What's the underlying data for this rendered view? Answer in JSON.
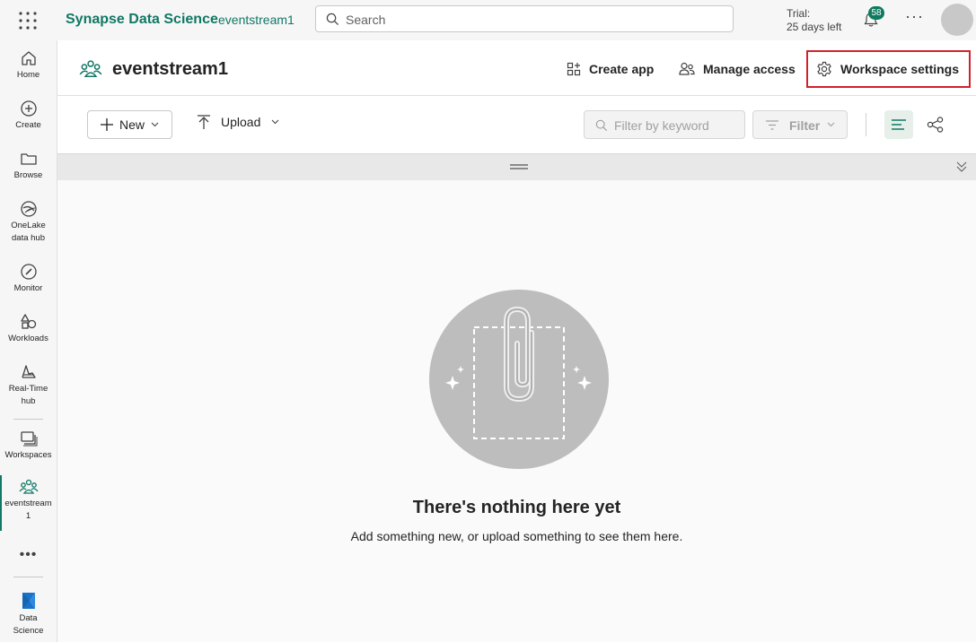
{
  "topbar": {
    "app_name": "Synapse Data Science",
    "workspace_crumb": "eventstream1",
    "search_placeholder": "Search",
    "trial_label": "Trial:",
    "trial_days": "25 days left",
    "notification_count": "58",
    "more_label": "···"
  },
  "rail": {
    "items": [
      {
        "label": "Home",
        "icon": "home-icon"
      },
      {
        "label": "Create",
        "icon": "plus-circle-icon"
      },
      {
        "label": "Browse",
        "icon": "folder-icon"
      },
      {
        "label": "OneLake\ndata hub",
        "icon": "onelake-icon"
      },
      {
        "label": "Monitor",
        "icon": "monitor-icon"
      },
      {
        "label": "Workloads",
        "icon": "workloads-icon"
      },
      {
        "label": "Real-Time\nhub",
        "icon": "realtime-icon"
      },
      {
        "label": "Workspaces",
        "icon": "workspaces-icon"
      },
      {
        "label": "eventstream\n1",
        "icon": "workspace-people-icon"
      },
      {
        "label": "Data\nScience",
        "icon": "data-science-icon"
      }
    ],
    "more_label": "•••"
  },
  "header": {
    "workspace_title": "eventstream1",
    "create_app": "Create app",
    "manage_access": "Manage access",
    "workspace_settings": "Workspace settings"
  },
  "toolbar": {
    "new_label": "New",
    "upload_label": "Upload",
    "filter_placeholder": "Filter by keyword",
    "filter_label": "Filter"
  },
  "empty_state": {
    "title": "There's nothing here yet",
    "description": "Add something new, or upload something to see them here."
  },
  "colors": {
    "brand": "#117865",
    "highlight_border": "#d1212a",
    "badge": "#0e7a5f"
  }
}
